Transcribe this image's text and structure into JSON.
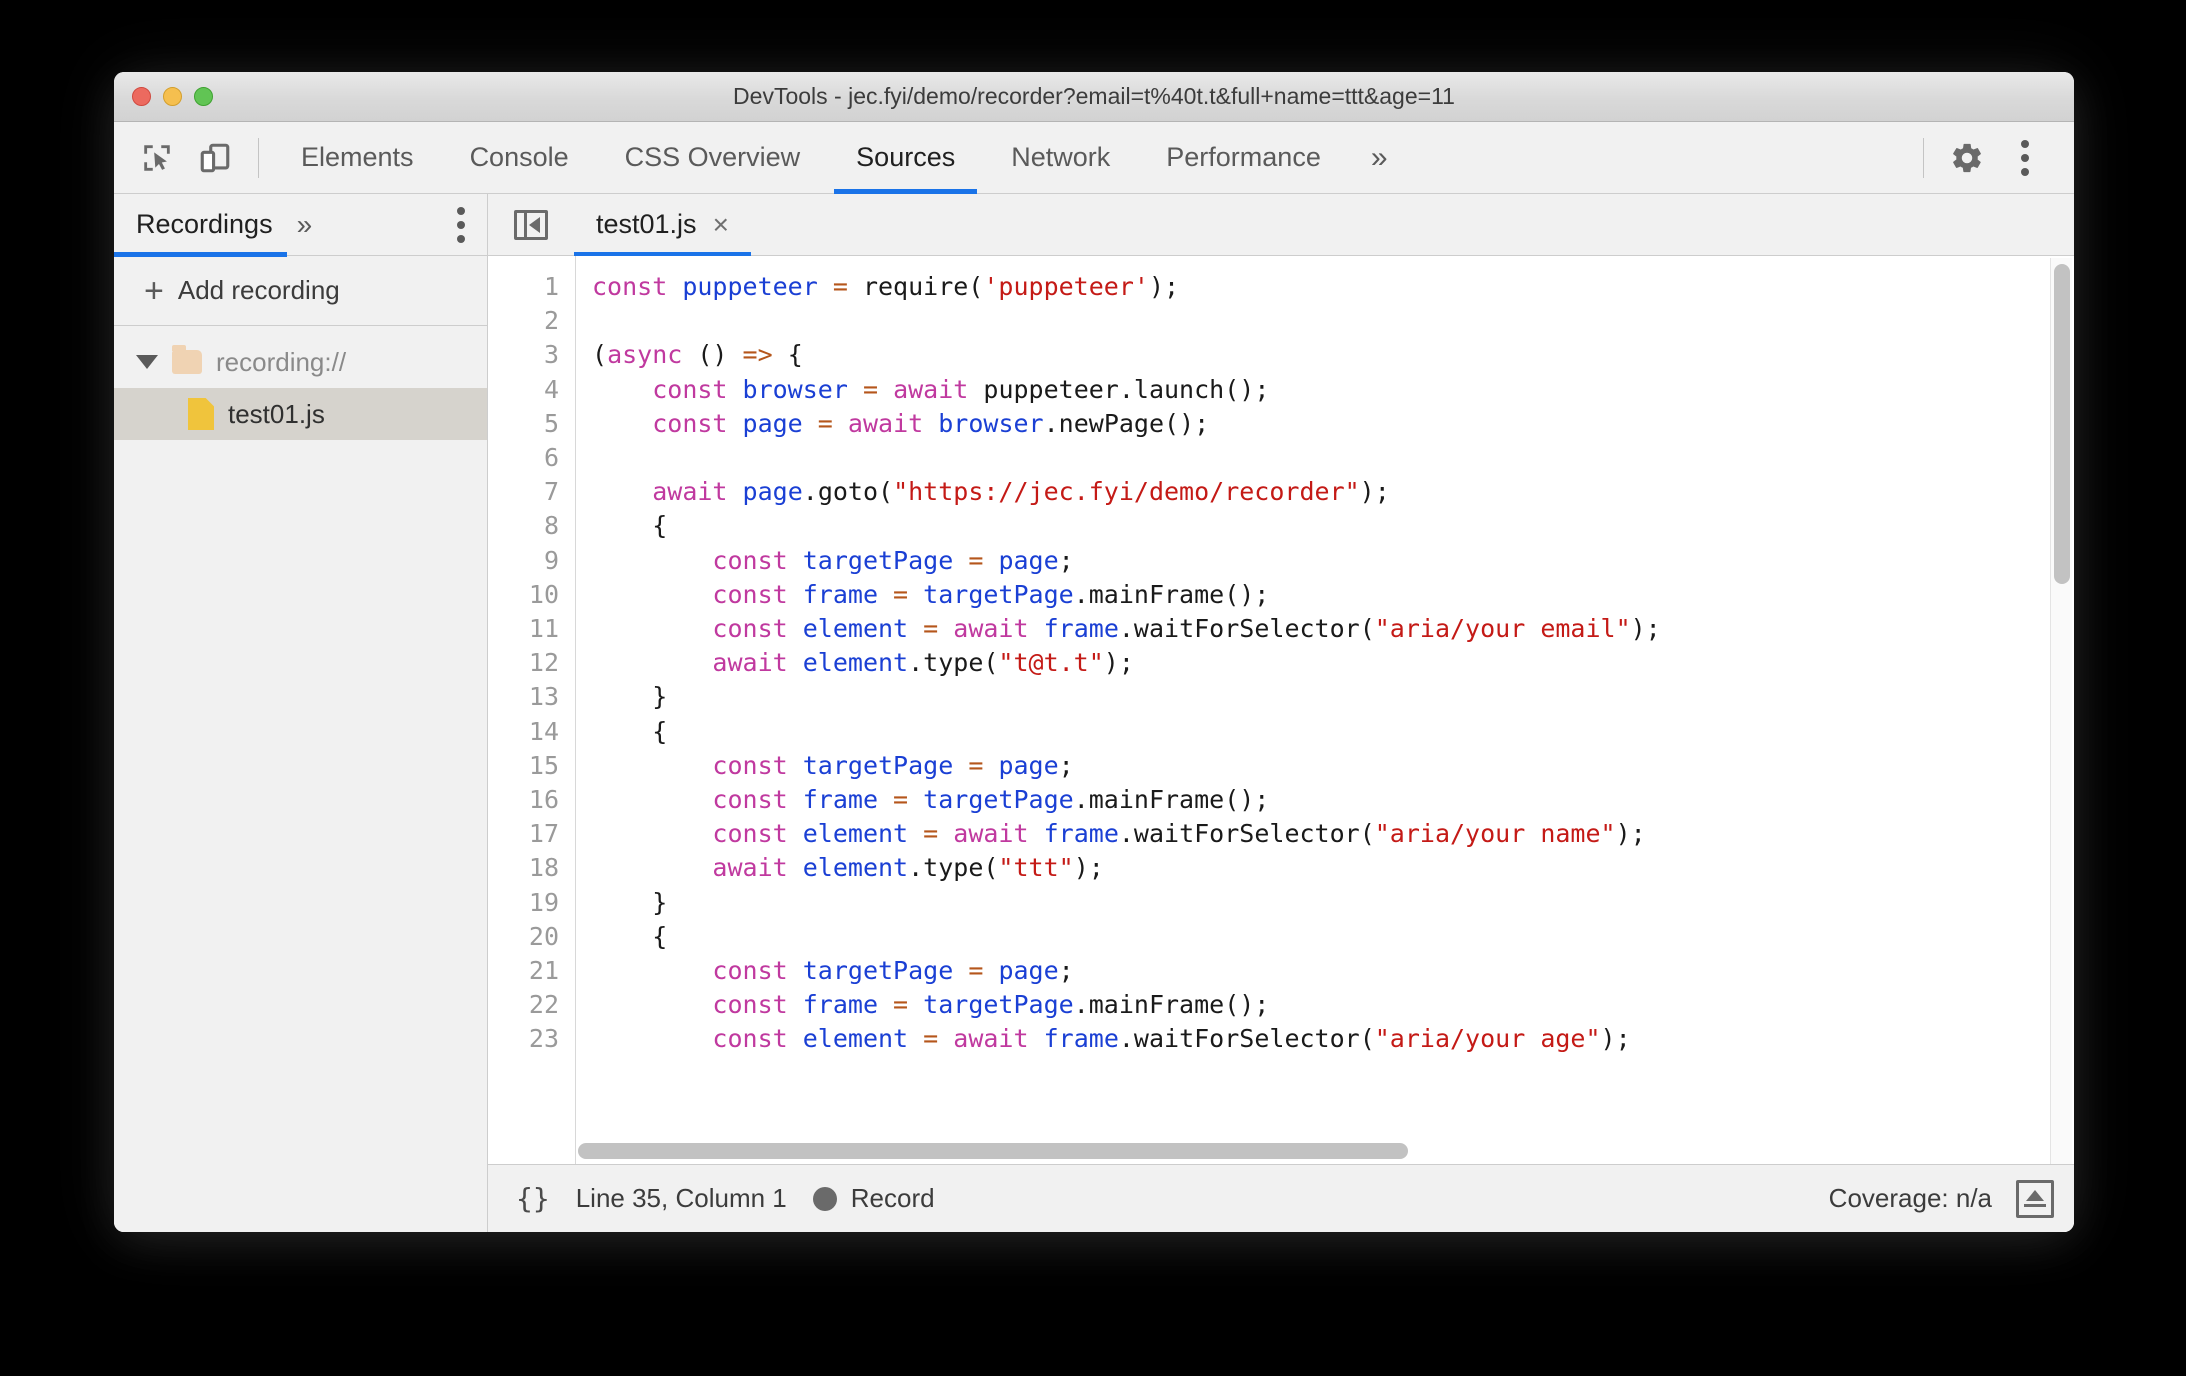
{
  "window": {
    "title": "DevTools - jec.fyi/demo/recorder?email=t%40t.t&full+name=ttt&age=11"
  },
  "toolbar": {
    "inspect_icon": "inspect-element-icon",
    "device_icon": "device-toolbar-icon",
    "tabs": [
      {
        "label": "Elements",
        "active": false
      },
      {
        "label": "Console",
        "active": false
      },
      {
        "label": "CSS Overview",
        "active": false
      },
      {
        "label": "Sources",
        "active": true
      },
      {
        "label": "Network",
        "active": false
      },
      {
        "label": "Performance",
        "active": false
      }
    ],
    "more_tabs": "»",
    "settings_icon": "gear-icon",
    "menu_icon": "kebab-menu-icon",
    "accent_color": "#1a73e8"
  },
  "sidebar": {
    "tab_label": "Recordings",
    "more_chevron": "»",
    "menu_icon": "kebab-menu-icon",
    "add_recording": "Add recording",
    "add_plus": "+",
    "tree": [
      {
        "label": "recording://",
        "type": "folder",
        "expanded": true
      },
      {
        "label": "test01.js",
        "type": "file",
        "selected": true
      }
    ]
  },
  "editor": {
    "panel_toggle_icon": "collapse-sidebar-icon",
    "tab_label": "test01.js",
    "close_icon": "×",
    "first_line": 1,
    "lines": [
      {
        "n": 1,
        "tokens": [
          {
            "t": "const ",
            "c": "k"
          },
          {
            "t": "puppeteer ",
            "c": "v"
          },
          {
            "t": "=",
            "c": "o"
          },
          {
            "t": " require(",
            "c": "p"
          },
          {
            "t": "'puppeteer'",
            "c": "s"
          },
          {
            "t": ");",
            "c": "p"
          }
        ]
      },
      {
        "n": 2,
        "tokens": []
      },
      {
        "n": 3,
        "tokens": [
          {
            "t": "(",
            "c": "p"
          },
          {
            "t": "async",
            "c": "k"
          },
          {
            "t": " () ",
            "c": "p"
          },
          {
            "t": "=>",
            "c": "o"
          },
          {
            "t": " {",
            "c": "p"
          }
        ]
      },
      {
        "n": 4,
        "tokens": [
          {
            "t": "    ",
            "c": "p"
          },
          {
            "t": "const ",
            "c": "k"
          },
          {
            "t": "browser ",
            "c": "v"
          },
          {
            "t": "=",
            "c": "o"
          },
          {
            "t": " ",
            "c": "p"
          },
          {
            "t": "await",
            "c": "k"
          },
          {
            "t": " puppeteer.launch();",
            "c": "p"
          }
        ]
      },
      {
        "n": 5,
        "tokens": [
          {
            "t": "    ",
            "c": "p"
          },
          {
            "t": "const ",
            "c": "k"
          },
          {
            "t": "page ",
            "c": "v"
          },
          {
            "t": "=",
            "c": "o"
          },
          {
            "t": " ",
            "c": "p"
          },
          {
            "t": "await",
            "c": "k"
          },
          {
            "t": " ",
            "c": "p"
          },
          {
            "t": "browser",
            "c": "v"
          },
          {
            "t": ".newPage();",
            "c": "p"
          }
        ]
      },
      {
        "n": 6,
        "tokens": []
      },
      {
        "n": 7,
        "tokens": [
          {
            "t": "    ",
            "c": "p"
          },
          {
            "t": "await",
            "c": "k"
          },
          {
            "t": " ",
            "c": "p"
          },
          {
            "t": "page",
            "c": "v"
          },
          {
            "t": ".goto(",
            "c": "p"
          },
          {
            "t": "\"https://jec.fyi/demo/recorder\"",
            "c": "s"
          },
          {
            "t": ");",
            "c": "p"
          }
        ]
      },
      {
        "n": 8,
        "tokens": [
          {
            "t": "    {",
            "c": "p"
          }
        ]
      },
      {
        "n": 9,
        "tokens": [
          {
            "t": "        ",
            "c": "p"
          },
          {
            "t": "const ",
            "c": "k"
          },
          {
            "t": "targetPage ",
            "c": "v"
          },
          {
            "t": "=",
            "c": "o"
          },
          {
            "t": " ",
            "c": "p"
          },
          {
            "t": "page",
            "c": "v"
          },
          {
            "t": ";",
            "c": "p"
          }
        ]
      },
      {
        "n": 10,
        "tokens": [
          {
            "t": "        ",
            "c": "p"
          },
          {
            "t": "const ",
            "c": "k"
          },
          {
            "t": "frame ",
            "c": "v"
          },
          {
            "t": "=",
            "c": "o"
          },
          {
            "t": " ",
            "c": "p"
          },
          {
            "t": "targetPage",
            "c": "v"
          },
          {
            "t": ".mainFrame();",
            "c": "p"
          }
        ]
      },
      {
        "n": 11,
        "tokens": [
          {
            "t": "        ",
            "c": "p"
          },
          {
            "t": "const ",
            "c": "k"
          },
          {
            "t": "element ",
            "c": "v"
          },
          {
            "t": "=",
            "c": "o"
          },
          {
            "t": " ",
            "c": "p"
          },
          {
            "t": "await",
            "c": "k"
          },
          {
            "t": " ",
            "c": "p"
          },
          {
            "t": "frame",
            "c": "v"
          },
          {
            "t": ".waitForSelector(",
            "c": "p"
          },
          {
            "t": "\"aria/your email\"",
            "c": "s"
          },
          {
            "t": ");",
            "c": "p"
          }
        ]
      },
      {
        "n": 12,
        "tokens": [
          {
            "t": "        ",
            "c": "p"
          },
          {
            "t": "await",
            "c": "k"
          },
          {
            "t": " ",
            "c": "p"
          },
          {
            "t": "element",
            "c": "v"
          },
          {
            "t": ".type(",
            "c": "p"
          },
          {
            "t": "\"t@t.t\"",
            "c": "s"
          },
          {
            "t": ");",
            "c": "p"
          }
        ]
      },
      {
        "n": 13,
        "tokens": [
          {
            "t": "    }",
            "c": "p"
          }
        ]
      },
      {
        "n": 14,
        "tokens": [
          {
            "t": "    {",
            "c": "p"
          }
        ]
      },
      {
        "n": 15,
        "tokens": [
          {
            "t": "        ",
            "c": "p"
          },
          {
            "t": "const ",
            "c": "k"
          },
          {
            "t": "targetPage ",
            "c": "v"
          },
          {
            "t": "=",
            "c": "o"
          },
          {
            "t": " ",
            "c": "p"
          },
          {
            "t": "page",
            "c": "v"
          },
          {
            "t": ";",
            "c": "p"
          }
        ]
      },
      {
        "n": 16,
        "tokens": [
          {
            "t": "        ",
            "c": "p"
          },
          {
            "t": "const ",
            "c": "k"
          },
          {
            "t": "frame ",
            "c": "v"
          },
          {
            "t": "=",
            "c": "o"
          },
          {
            "t": " ",
            "c": "p"
          },
          {
            "t": "targetPage",
            "c": "v"
          },
          {
            "t": ".mainFrame();",
            "c": "p"
          }
        ]
      },
      {
        "n": 17,
        "tokens": [
          {
            "t": "        ",
            "c": "p"
          },
          {
            "t": "const ",
            "c": "k"
          },
          {
            "t": "element ",
            "c": "v"
          },
          {
            "t": "=",
            "c": "o"
          },
          {
            "t": " ",
            "c": "p"
          },
          {
            "t": "await",
            "c": "k"
          },
          {
            "t": " ",
            "c": "p"
          },
          {
            "t": "frame",
            "c": "v"
          },
          {
            "t": ".waitForSelector(",
            "c": "p"
          },
          {
            "t": "\"aria/your name\"",
            "c": "s"
          },
          {
            "t": ");",
            "c": "p"
          }
        ]
      },
      {
        "n": 18,
        "tokens": [
          {
            "t": "        ",
            "c": "p"
          },
          {
            "t": "await",
            "c": "k"
          },
          {
            "t": " ",
            "c": "p"
          },
          {
            "t": "element",
            "c": "v"
          },
          {
            "t": ".type(",
            "c": "p"
          },
          {
            "t": "\"ttt\"",
            "c": "s"
          },
          {
            "t": ");",
            "c": "p"
          }
        ]
      },
      {
        "n": 19,
        "tokens": [
          {
            "t": "    }",
            "c": "p"
          }
        ]
      },
      {
        "n": 20,
        "tokens": [
          {
            "t": "    {",
            "c": "p"
          }
        ]
      },
      {
        "n": 21,
        "tokens": [
          {
            "t": "        ",
            "c": "p"
          },
          {
            "t": "const ",
            "c": "k"
          },
          {
            "t": "targetPage ",
            "c": "v"
          },
          {
            "t": "=",
            "c": "o"
          },
          {
            "t": " ",
            "c": "p"
          },
          {
            "t": "page",
            "c": "v"
          },
          {
            "t": ";",
            "c": "p"
          }
        ]
      },
      {
        "n": 22,
        "tokens": [
          {
            "t": "        ",
            "c": "p"
          },
          {
            "t": "const ",
            "c": "k"
          },
          {
            "t": "frame ",
            "c": "v"
          },
          {
            "t": "=",
            "c": "o"
          },
          {
            "t": " ",
            "c": "p"
          },
          {
            "t": "targetPage",
            "c": "v"
          },
          {
            "t": ".mainFrame();",
            "c": "p"
          }
        ]
      },
      {
        "n": 23,
        "tokens": [
          {
            "t": "        ",
            "c": "p"
          },
          {
            "t": "const ",
            "c": "k"
          },
          {
            "t": "element ",
            "c": "v"
          },
          {
            "t": "=",
            "c": "o"
          },
          {
            "t": " ",
            "c": "p"
          },
          {
            "t": "await",
            "c": "k"
          },
          {
            "t": " ",
            "c": "p"
          },
          {
            "t": "frame",
            "c": "v"
          },
          {
            "t": ".waitForSelector(",
            "c": "p"
          },
          {
            "t": "\"aria/your age\"",
            "c": "s"
          },
          {
            "t": ");",
            "c": "p"
          }
        ]
      }
    ]
  },
  "status": {
    "format_label": "{}",
    "cursor_position": "Line 35, Column 1",
    "record_label": "Record",
    "record_dot_color": "#6a6a6a",
    "coverage": "Coverage: n/a",
    "drawer_icon": "show-drawer-icon"
  }
}
